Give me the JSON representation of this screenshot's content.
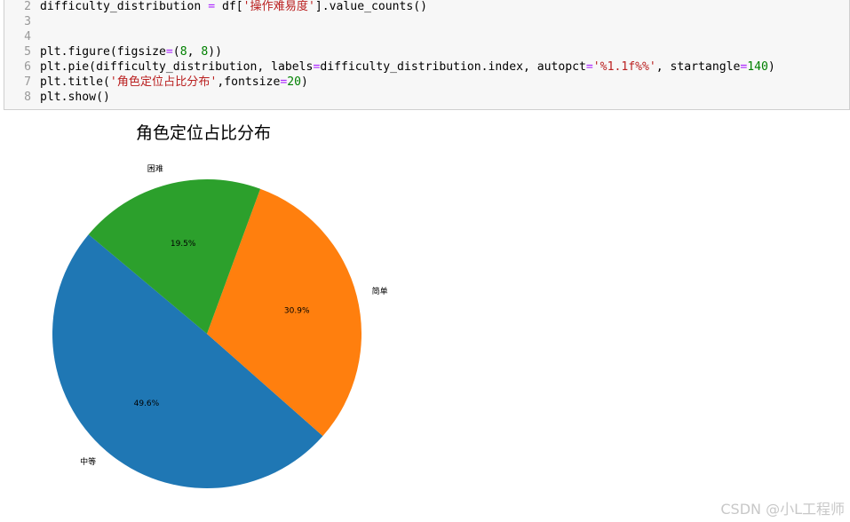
{
  "code": {
    "lines": [
      {
        "num": "2",
        "tokens": [
          {
            "t": "difficulty_distribution ",
            "c": ""
          },
          {
            "t": "=",
            "c": "op"
          },
          {
            "t": " df[",
            "c": ""
          },
          {
            "t": "'操作难易度'",
            "c": "str"
          },
          {
            "t": "].value_counts()",
            "c": ""
          }
        ]
      },
      {
        "num": "3",
        "tokens": []
      },
      {
        "num": "4",
        "tokens": []
      },
      {
        "num": "5",
        "tokens": [
          {
            "t": "plt.figure(figsize",
            "c": ""
          },
          {
            "t": "=",
            "c": "op"
          },
          {
            "t": "(",
            "c": ""
          },
          {
            "t": "8",
            "c": "num"
          },
          {
            "t": ", ",
            "c": ""
          },
          {
            "t": "8",
            "c": "num"
          },
          {
            "t": "))",
            "c": ""
          }
        ]
      },
      {
        "num": "6",
        "tokens": [
          {
            "t": "plt.pie(difficulty_distribution, labels",
            "c": ""
          },
          {
            "t": "=",
            "c": "op"
          },
          {
            "t": "difficulty_distribution.index, autopct",
            "c": ""
          },
          {
            "t": "=",
            "c": "op"
          },
          {
            "t": "'%1.1f%%'",
            "c": "str"
          },
          {
            "t": ", startangle",
            "c": ""
          },
          {
            "t": "=",
            "c": "op"
          },
          {
            "t": "140",
            "c": "num"
          },
          {
            "t": ")",
            "c": ""
          }
        ]
      },
      {
        "num": "7",
        "tokens": [
          {
            "t": "plt.title(",
            "c": ""
          },
          {
            "t": "'角色定位占比分布'",
            "c": "str"
          },
          {
            "t": ",fontsize",
            "c": ""
          },
          {
            "t": "=",
            "c": "op"
          },
          {
            "t": "20",
            "c": "num"
          },
          {
            "t": ")",
            "c": ""
          }
        ]
      },
      {
        "num": "8",
        "tokens": [
          {
            "t": "plt.show()",
            "c": ""
          }
        ]
      }
    ]
  },
  "chart_data": {
    "type": "pie",
    "title": "角色定位占比分布",
    "categories": [
      "中等",
      "简单",
      "困难"
    ],
    "values": [
      49.6,
      30.9,
      19.5
    ],
    "pct_labels": [
      "49.6%",
      "30.9%",
      "19.5%"
    ],
    "colors": [
      "#1f77b4",
      "#ff7f0e",
      "#2ca02c"
    ],
    "startangle": 140
  },
  "watermark": "CSDN @小L工程师"
}
